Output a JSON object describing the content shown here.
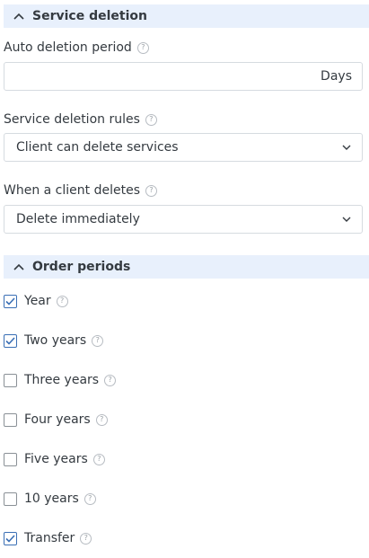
{
  "service_deletion": {
    "title": "Service deletion",
    "auto_period_label": "Auto deletion period",
    "auto_period_value": "",
    "auto_period_suffix": "Days",
    "rules_label": "Service deletion rules",
    "rules_value": "Client can delete services",
    "client_deletes_label": "When a client deletes",
    "client_deletes_value": "Delete immediately"
  },
  "order_periods": {
    "title": "Order periods",
    "items": [
      {
        "label": "Year",
        "checked": true
      },
      {
        "label": "Two years",
        "checked": true
      },
      {
        "label": "Three years",
        "checked": false
      },
      {
        "label": "Four years",
        "checked": false
      },
      {
        "label": "Five years",
        "checked": false
      },
      {
        "label": "10 years",
        "checked": false
      },
      {
        "label": "Transfer",
        "checked": true
      }
    ]
  },
  "help_glyph": "?",
  "colors": {
    "header_bg": "#e8f0fc",
    "accent": "#3a6fb5",
    "text": "#343a40",
    "border": "#d6dbe0"
  }
}
